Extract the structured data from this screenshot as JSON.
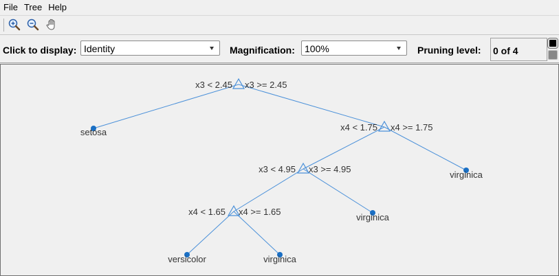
{
  "menu": {
    "items": [
      "File",
      "Tree",
      "Help"
    ]
  },
  "toolbar": {
    "buttons": [
      "zoom-in-icon",
      "zoom-out-icon",
      "pan-hand-icon"
    ]
  },
  "controls": {
    "display_label": "Click to display:",
    "display_value": "Identity",
    "magnification_label": "Magnification:",
    "magnification_value": "100%",
    "pruning_label": "Pruning level:",
    "pruning_value": "0 of 4"
  },
  "colors": {
    "edge": "#4a90d9",
    "node": "#1a6fc4",
    "branch_marker": "#4a90d9"
  },
  "tree": {
    "branches": [
      {
        "left_rule": "x3 < 2.45",
        "right_rule": "x3 >= 2.45"
      },
      {
        "left_rule": "x4 < 1.75",
        "right_rule": "x4 >= 1.75"
      },
      {
        "left_rule": "x3 < 4.95",
        "right_rule": "x3 >= 4.95"
      },
      {
        "left_rule": "x4 < 1.65",
        "right_rule": "x4 >= 1.65"
      }
    ],
    "leaves": [
      "setosa",
      "virginica",
      "virginica",
      "versicolor",
      "virginica"
    ]
  }
}
